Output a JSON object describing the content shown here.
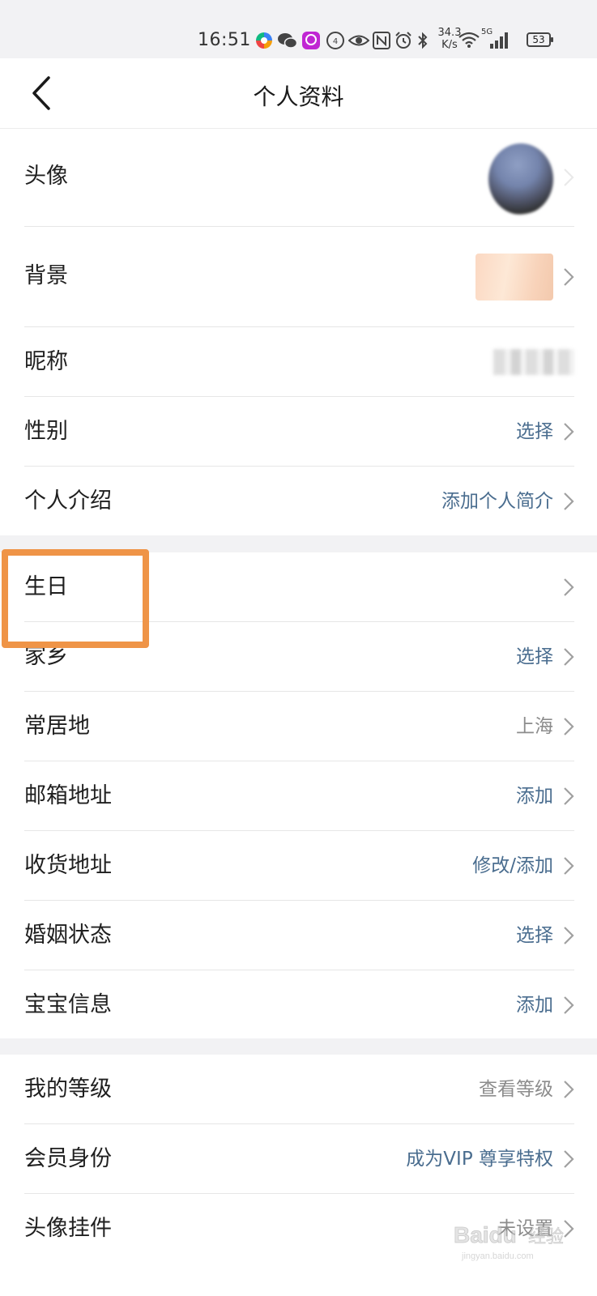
{
  "status_bar": {
    "time": "16:51",
    "net_speed_value": "34.3",
    "net_speed_unit": "K/s",
    "signal_label": "5G",
    "battery": "53",
    "icons": [
      "app-icon",
      "wechat-icon",
      "app-icon",
      "app-icon",
      "eye-icon",
      "nfc-icon",
      "alarm-icon",
      "bluetooth-icon",
      "wifi-icon",
      "signal-icon",
      "battery-icon"
    ]
  },
  "header": {
    "title": "个人资料",
    "back_icon": "chevron-left-icon"
  },
  "groups": [
    {
      "rows": [
        {
          "label": "头像",
          "value": "",
          "kind": "avatar"
        },
        {
          "label": "背景",
          "value": "",
          "kind": "background"
        },
        {
          "label": "昵称",
          "value": "",
          "kind": "nickname"
        },
        {
          "label": "性别",
          "value": "选择",
          "tone": "link"
        },
        {
          "label": "个人介绍",
          "value": "添加个人简介",
          "tone": "link"
        }
      ]
    },
    {
      "rows": [
        {
          "label": "生日",
          "value": ""
        },
        {
          "label": "家乡",
          "value": "选择",
          "tone": "link"
        },
        {
          "label": "常居地",
          "value": "上海",
          "tone": "gray"
        },
        {
          "label": "邮箱地址",
          "value": "添加",
          "tone": "link"
        },
        {
          "label": "收货地址",
          "value": "修改/添加",
          "tone": "link"
        },
        {
          "label": "婚姻状态",
          "value": "选择",
          "tone": "link"
        },
        {
          "label": "宝宝信息",
          "value": "添加",
          "tone": "link"
        }
      ]
    },
    {
      "rows": [
        {
          "label": "我的等级",
          "value": "查看等级",
          "tone": "gray"
        },
        {
          "label": "会员身份",
          "value": "成为VIP 尊享特权",
          "tone": "link"
        },
        {
          "label": "头像挂件",
          "value": "未设置",
          "tone": "gray"
        }
      ]
    }
  ],
  "colors": {
    "link": "#4a6d8f",
    "gray": "#8c8c8c",
    "highlight": "#ef9447"
  },
  "watermark": "Baidu 经验"
}
